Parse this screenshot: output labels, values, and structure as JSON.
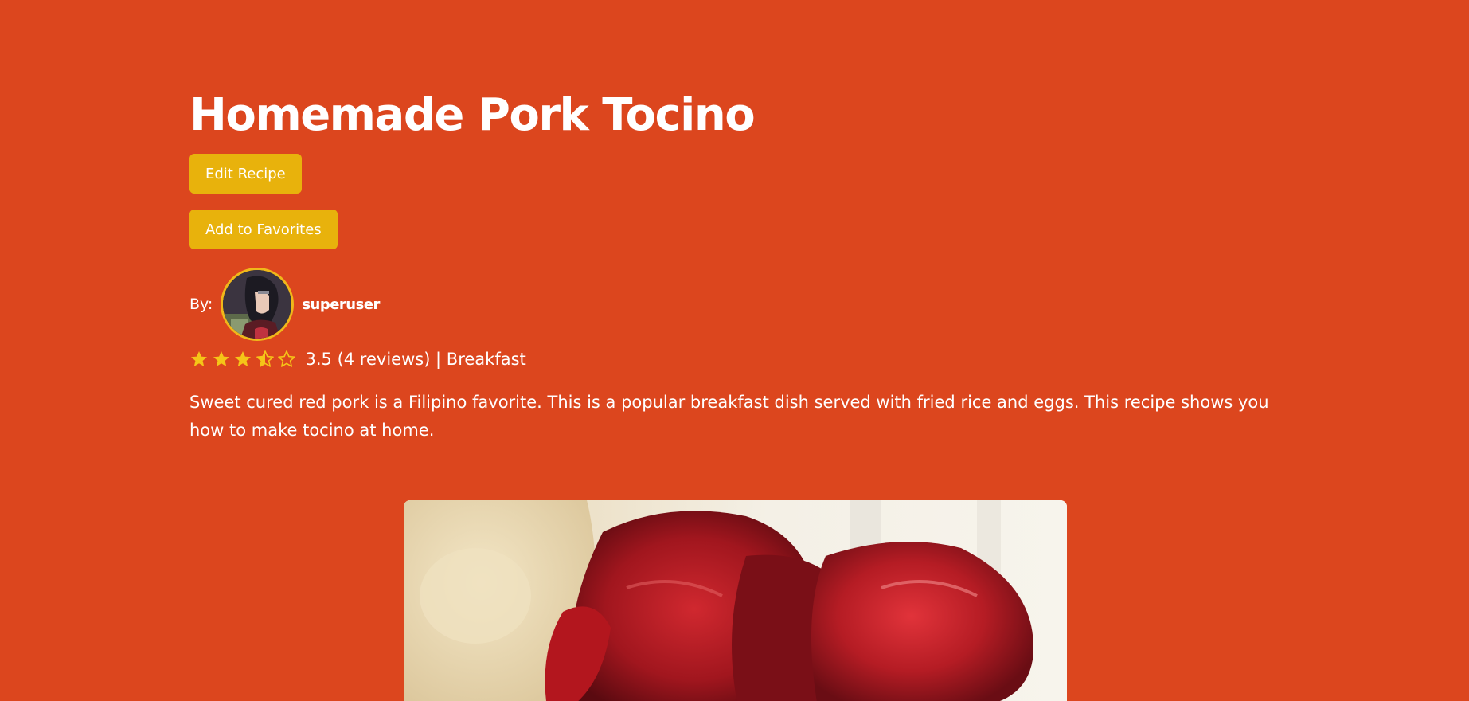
{
  "recipe": {
    "title": "Homemade Pork Tocino",
    "edit_button_label": "Edit Recipe",
    "favorite_button_label": "Add to Favorites",
    "author": {
      "by_label": "By:",
      "username": "superuser"
    },
    "rating": {
      "value": 3.5,
      "max": 5,
      "text": "3.5 (4 reviews) | Breakfast",
      "star_color": "#f5c518"
    },
    "description": "Sweet cured red pork is a Filipino favorite. This is a popular breakfast dish served with fried rice and eggs. This recipe shows you how to make tocino at home."
  },
  "theme": {
    "background": "#dc461e",
    "button": "#e8b20c",
    "avatar_border": "#f0b81a"
  },
  "icons": {
    "full_star": "star-icon",
    "half_star": "half-star-icon",
    "empty_star": "empty-star-icon"
  }
}
